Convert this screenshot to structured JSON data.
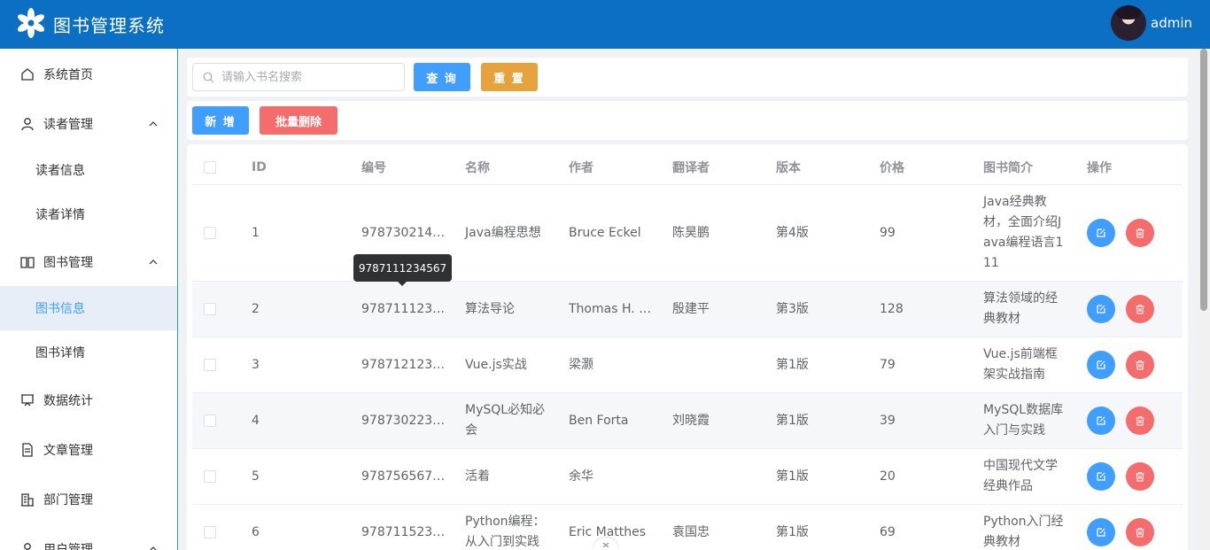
{
  "app": {
    "title": "图书管理系统",
    "username": "admin"
  },
  "sidebar": {
    "items": [
      {
        "label": "系统首页",
        "icon": "home-icon"
      },
      {
        "label": "读者管理",
        "icon": "user-icon",
        "expanded": true
      },
      {
        "label": "读者信息"
      },
      {
        "label": "读者详情"
      },
      {
        "label": "图书管理",
        "icon": "book-icon",
        "expanded": true
      },
      {
        "label": "图书信息",
        "active": true
      },
      {
        "label": "图书详情"
      },
      {
        "label": "数据统计",
        "icon": "chart-icon"
      },
      {
        "label": "文章管理",
        "icon": "document-icon"
      },
      {
        "label": "部门管理",
        "icon": "office-icon"
      },
      {
        "label": "用户管理",
        "icon": "user-icon",
        "expanded": true
      }
    ]
  },
  "search": {
    "placeholder": "请输入书名搜索",
    "value": ""
  },
  "toolbar": {
    "query_label": "查 询",
    "reset_label": "重 置",
    "add_label": "新 增",
    "batch_delete_label": "批量删除"
  },
  "table": {
    "headers": {
      "id": "ID",
      "isbn": "编号",
      "name": "名称",
      "author": "作者",
      "translator": "翻译者",
      "edition": "版本",
      "price": "价格",
      "intro": "图书简介",
      "ops": "操作"
    },
    "rows": [
      {
        "id": "1",
        "isbn": "978730214…",
        "name": "Java编程思想",
        "author": "Bruce Eckel",
        "translator": "陈昊鹏",
        "edition": "第4版",
        "price": "99",
        "intro": "Java经典教材，全面介绍Java编程语言111"
      },
      {
        "id": "2",
        "isbn": "978711123…",
        "name": "算法导论",
        "author": "Thomas H. …",
        "translator": "殷建平",
        "edition": "第3版",
        "price": "128",
        "intro": "算法领域的经典教材"
      },
      {
        "id": "3",
        "isbn": "978712123…",
        "name": "Vue.js实战",
        "author": "梁灏",
        "translator": "",
        "edition": "第1版",
        "price": "79",
        "intro": "Vue.js前端框架实战指南"
      },
      {
        "id": "4",
        "isbn": "978730223…",
        "name": "MySQL必知必会",
        "author": "Ben Forta",
        "translator": "刘晓霞",
        "edition": "第1版",
        "price": "39",
        "intro": "MySQL数据库入门与实践"
      },
      {
        "id": "5",
        "isbn": "978756567…",
        "name": "活着",
        "author": "余华",
        "translator": "",
        "edition": "第1版",
        "price": "20",
        "intro": "中国现代文学经典作品"
      },
      {
        "id": "6",
        "isbn": "978711523…",
        "name": "Python编程：从入门到实践",
        "author": "Eric Matthes",
        "translator": "袁国忠",
        "edition": "第1版",
        "price": "69",
        "intro": "Python入门经典教材"
      }
    ]
  },
  "tooltip": {
    "text": "9787111234567"
  },
  "colors": {
    "header": "#0b6fc4",
    "primary": "#409eff",
    "warning": "#e6a23c",
    "danger": "#f56c6c"
  }
}
